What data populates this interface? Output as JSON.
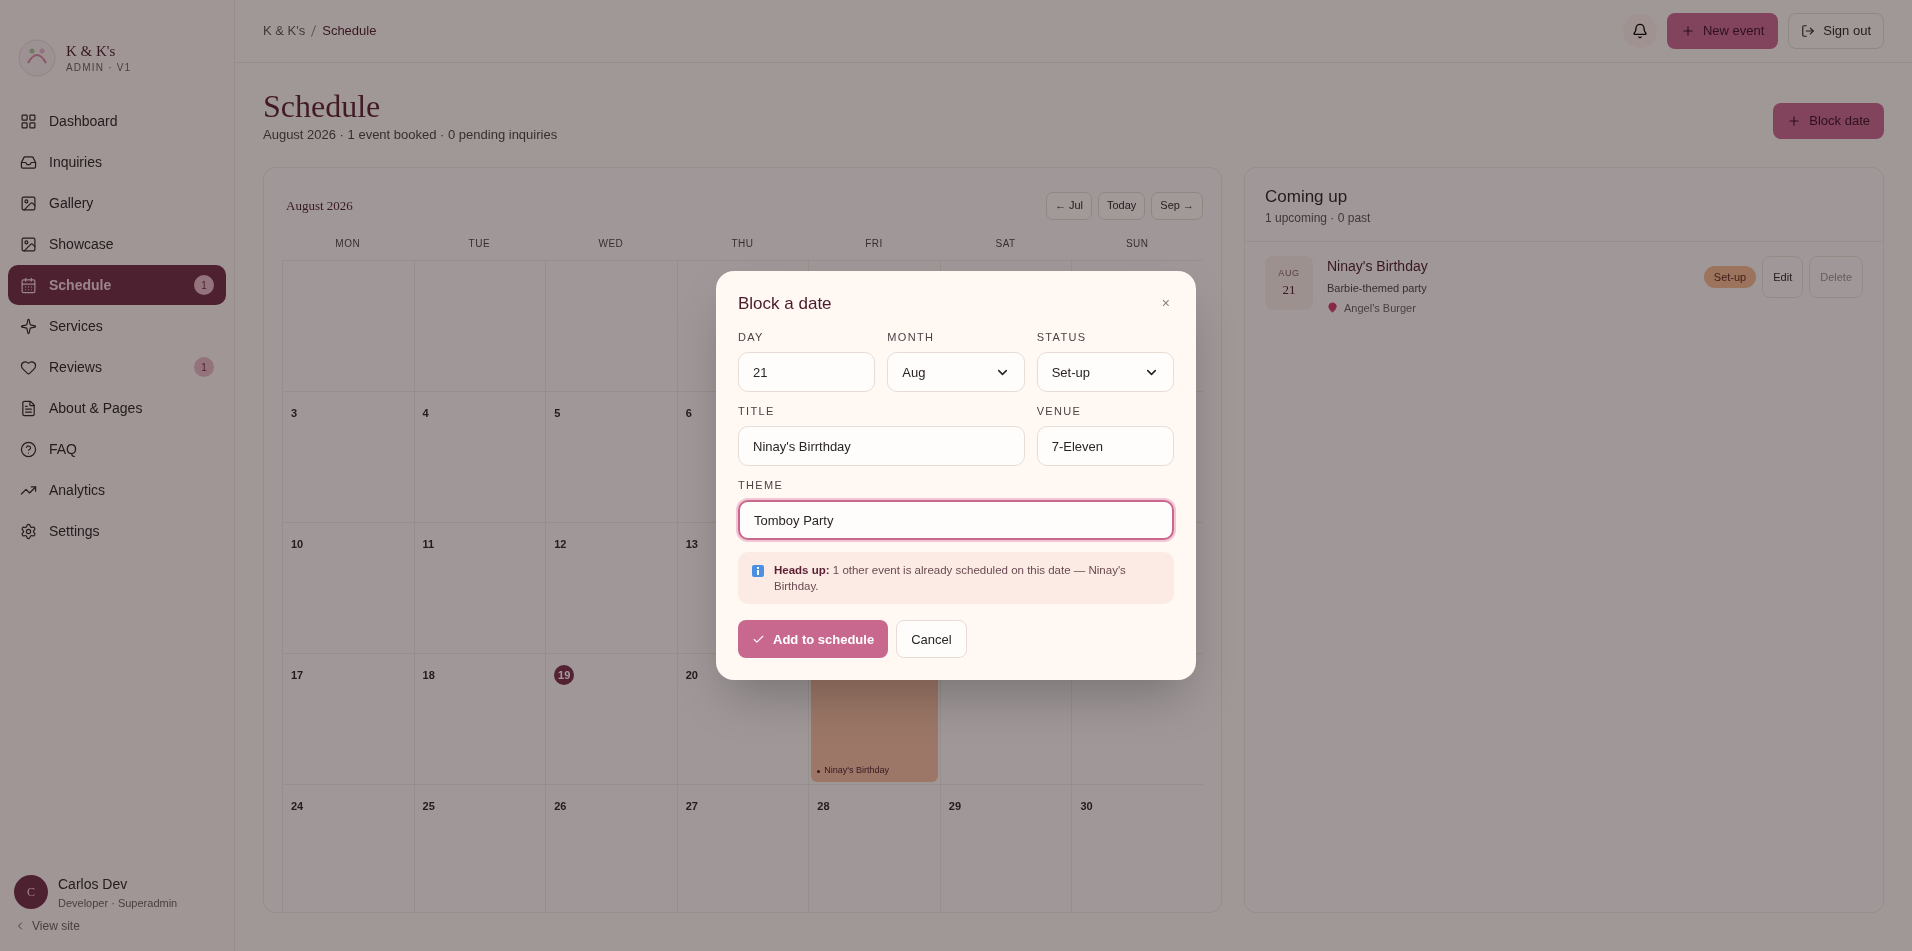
{
  "sidebar": {
    "brand": {
      "name": "K & K's",
      "subtitle": "ADMIN · V1"
    },
    "items": [
      {
        "label": "Dashboard",
        "selected": false
      },
      {
        "label": "Inquiries",
        "selected": false
      },
      {
        "label": "Gallery",
        "selected": false
      },
      {
        "label": "Showcase",
        "selected": false
      },
      {
        "label": "Schedule",
        "selected": true,
        "badge": "1"
      },
      {
        "label": "Services",
        "selected": false
      },
      {
        "label": "Reviews",
        "selected": false,
        "badge": "1"
      },
      {
        "label": "About & Pages",
        "selected": false
      },
      {
        "label": "FAQ",
        "selected": false
      },
      {
        "label": "Analytics",
        "selected": false
      },
      {
        "label": "Settings",
        "selected": false
      }
    ],
    "user": {
      "initial": "C",
      "name": "Carlos Dev",
      "role": "Developer · Superadmin"
    },
    "view_site": "View site"
  },
  "header": {
    "breadcrumb": [
      "K & K's",
      "Schedule"
    ],
    "new_event": "New event",
    "sign_out": "Sign out"
  },
  "page": {
    "title": "Schedule",
    "subtitle": "August 2026 · 1 event booked · 0 pending inquiries",
    "block_date": "Block date"
  },
  "calendar": {
    "month": "August 2026",
    "nav": [
      "← Jul",
      "Today",
      "Sep →"
    ],
    "weekdays": [
      "MON",
      "TUE",
      "WED",
      "THU",
      "FRI",
      "SAT",
      "SUN"
    ],
    "weeks": [
      [
        {
          "day": "3",
          "today": false
        },
        {
          "day": "4",
          "today": false
        },
        {
          "day": "5",
          "today": false
        },
        {
          "day": "6",
          "today": false
        }
      ],
      [
        {
          "day": "10",
          "today": false
        },
        {
          "day": "11",
          "today": false
        },
        {
          "day": "12",
          "today": false
        },
        {
          "day": "13",
          "today": false
        }
      ],
      [
        {
          "day": "17",
          "today": false
        },
        {
          "day": "18",
          "today": false
        },
        {
          "day": "19",
          "today": true
        },
        {
          "day": "20",
          "today": false
        },
        {
          "events": [
            "Ninay's Birthday"
          ]
        }
      ],
      [
        {
          "day": "24",
          "today": false
        },
        {
          "day": "25",
          "today": false
        },
        {
          "day": "26",
          "today": false
        },
        {
          "day": "27",
          "today": false
        },
        {
          "day": "28",
          "today": false
        },
        {
          "day": "29",
          "today": false
        },
        {
          "day": "30",
          "today": false
        }
      ]
    ]
  },
  "upcoming": {
    "title": "Coming up",
    "subtitle": "1 upcoming · 0 past",
    "events": [
      {
        "month": "AUG",
        "day": "21",
        "title": "Ninay's Birthday",
        "theme": "Barbie-themed party",
        "venue": "Angel's Burger",
        "status": "Set-up",
        "actions": [
          {
            "label": "Edit",
            "kind": "default"
          },
          {
            "label": "Delete",
            "kind": "danger"
          }
        ]
      }
    ]
  },
  "dialog": {
    "title": "Block a date",
    "close": "×",
    "fields": [
      {
        "label": "DAY",
        "kind": "text",
        "value": "21",
        "focused": false
      },
      {
        "label": "MONTH",
        "kind": "select",
        "value": "Aug",
        "focused": false
      },
      {
        "label": "STATUS",
        "kind": "select",
        "value": "Set-up",
        "focused": false
      },
      {
        "label": "TITLE",
        "kind": "text",
        "value": "Ninay's Birrthday",
        "focused": false
      },
      {
        "label": "VENUE",
        "kind": "text",
        "value": "7-Eleven",
        "focused": false
      },
      {
        "label": "THEME",
        "kind": "text",
        "value": "Tomboy Party",
        "focused": true
      }
    ],
    "notice": "**Heads up:** 1 other event is already scheduled on this date — Ninay's Birthday.",
    "buttons": [
      {
        "label": "Add to schedule",
        "kind": "primary"
      },
      {
        "label": "Cancel",
        "kind": "secondary"
      }
    ]
  }
}
